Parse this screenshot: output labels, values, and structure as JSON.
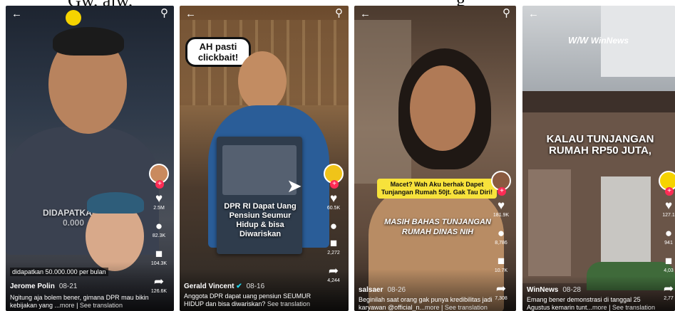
{
  "caption_fragments": {
    "left": "Gw. alw.",
    "right": "g"
  },
  "panels": [
    {
      "overlay_lines": [
        "DIDAPATKAN",
        "0.000"
      ],
      "caption_bar": "didapatkan 50.000.000 per bulan",
      "rail": {
        "likes": "2.5M",
        "comments": "82.3K",
        "saves": "104.3K",
        "shares": "126.6K"
      },
      "author": "Jerome Polin",
      "date": "08-21",
      "desc": "Ngitung aja bolem bener, gimana DPR mau bikin kebijakan yang ...",
      "more": "more",
      "translate": "See translation"
    },
    {
      "bubble": "AH pasti clickbait!",
      "card_title": "DPR RI Dapat Uang Pensiun Seumur Hidup & bisa Diwariskan",
      "rail": {
        "likes": "60.5K",
        "comments": "2,272",
        "saves": "4,244"
      },
      "author": "Gerald Vincent",
      "date": "08-16",
      "desc": "Anggota DPR dapat uang pensiun SEUMUR HIDUP dan bisa diwariskan?",
      "translate": "See translation"
    },
    {
      "yellow_box": "Macet? Wah Aku berhak Dapet Tunjangan Rumah 50jt. Gak Tau Diri!",
      "overlay_lines": [
        "MASIH BAHAS TUNJANGAN",
        "RUMAH DINAS NIH"
      ],
      "rail": {
        "likes": "181.9K",
        "comments": "8,786",
        "saves": "10.7K",
        "shares": "7,308"
      },
      "author": "salsaer",
      "date": "08-26",
      "desc": "Beginilah saat orang gak punya kredibilitas jadi karyawan @official_n...",
      "more": "more",
      "translate": "See translation"
    },
    {
      "brand": "WinNews",
      "headline": "KALAU TUNJANGAN RUMAH RP50 JUTA,",
      "rail": {
        "likes": "127.1",
        "comments": "941",
        "saves": "4,03",
        "shares": "2,77"
      },
      "author": "WinNews",
      "date": "08-28",
      "desc": "Emang bener demonstrasi di tanggal 25 Agustus kemarin tunt...",
      "more": "more",
      "translate": "See translation"
    }
  ],
  "icons": [
    "back-arrow-icon",
    "search-icon",
    "heart-icon",
    "comment-icon",
    "bookmark-icon",
    "share-icon",
    "plus-icon"
  ],
  "colors": {
    "tiktok_red": "#fe2c55",
    "yellow": "#f7e23b"
  }
}
